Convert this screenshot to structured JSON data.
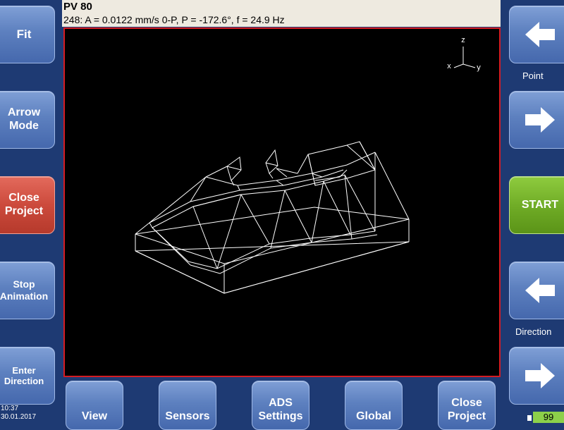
{
  "header": {
    "title": "PV 80",
    "info": "248: A = 0.0122 mm/s 0-P, P = -172.6°, f = 24.9 Hz"
  },
  "left_buttons": {
    "fit": "Fit",
    "arrow_mode": "Arrow\nMode",
    "close_project": "Close\nProject",
    "stop_animation": "Stop\nAnimation",
    "enter_direction": "Enter\nDirection"
  },
  "right_panel": {
    "point_label": "Point",
    "start": "START",
    "direction_label": "Direction",
    "arrow_left_icon": "arrow-left-icon",
    "arrow_right_icon": "arrow-right-icon"
  },
  "bottom_buttons": {
    "view": "View",
    "sensors": "Sensors",
    "ads_settings": "ADS\nSettings",
    "global": "Global",
    "close_project": "Close\nProject"
  },
  "axes": {
    "z": "z",
    "x": "x",
    "y": "y"
  },
  "status": {
    "time": "10:37",
    "date": "30.01.2017",
    "counter": "99"
  },
  "colors": {
    "background": "#1e3a73",
    "viewport_border": "#d41c23",
    "header_bg": "#eeeae0",
    "start_green": "#6eaa25",
    "close_red": "#cc4a3c",
    "counter_green": "#8cd04a"
  }
}
